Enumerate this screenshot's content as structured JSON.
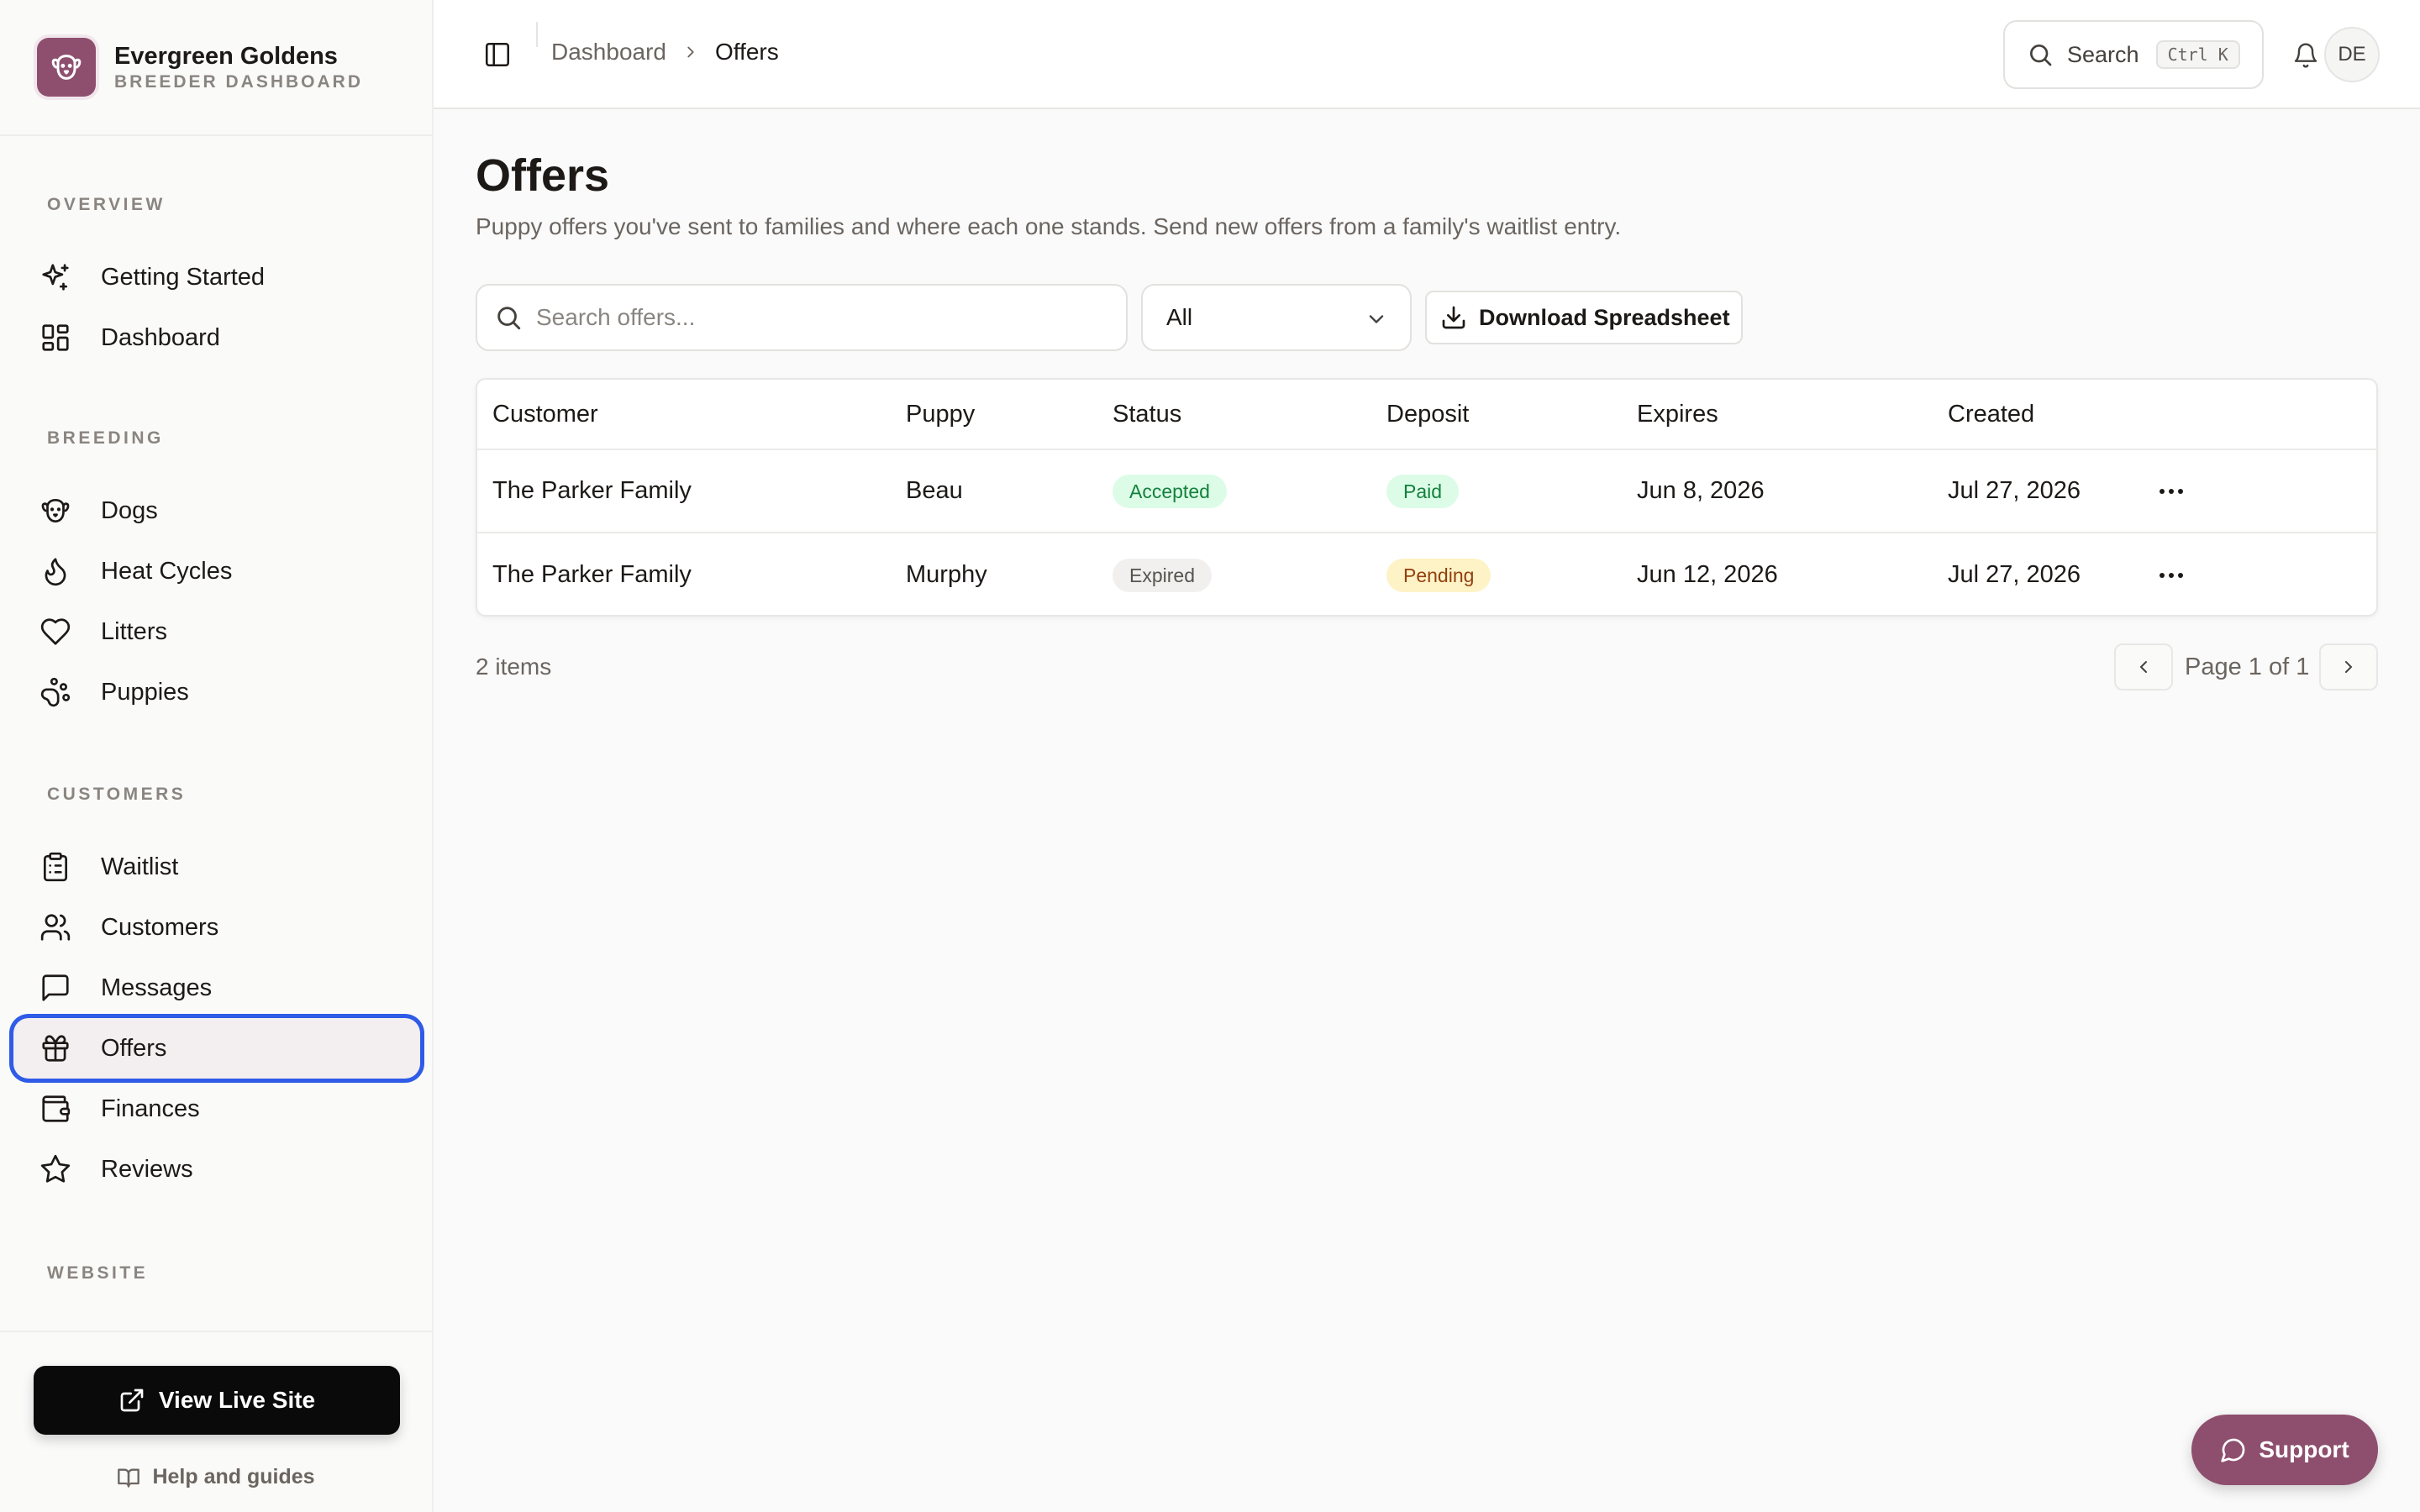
{
  "brand": {
    "name": "Evergreen Goldens",
    "subtitle": "BREEDER DASHBOARD",
    "logo_icon": "dog-face-icon",
    "color": "#8e4f6f"
  },
  "sidebar": {
    "sections": [
      {
        "label": "OVERVIEW",
        "items": [
          {
            "label": "Getting Started",
            "icon": "sparkles-icon"
          },
          {
            "label": "Dashboard",
            "icon": "layout-grid-icon"
          }
        ]
      },
      {
        "label": "BREEDING",
        "items": [
          {
            "label": "Dogs",
            "icon": "dog-icon"
          },
          {
            "label": "Heat Cycles",
            "icon": "flame-icon"
          },
          {
            "label": "Litters",
            "icon": "heart-icon"
          },
          {
            "label": "Puppies",
            "icon": "paw-icon"
          }
        ]
      },
      {
        "label": "CUSTOMERS",
        "items": [
          {
            "label": "Waitlist",
            "icon": "clipboard-list-icon"
          },
          {
            "label": "Customers",
            "icon": "users-icon"
          },
          {
            "label": "Messages",
            "icon": "message-square-icon"
          },
          {
            "label": "Offers",
            "icon": "gift-icon",
            "active": true
          },
          {
            "label": "Finances",
            "icon": "wallet-icon"
          },
          {
            "label": "Reviews",
            "icon": "star-icon"
          }
        ]
      },
      {
        "label": "WEBSITE",
        "items": []
      }
    ],
    "live_site_button": "View Live Site",
    "help_link": "Help and guides",
    "active_outline_color": "#2f5be7"
  },
  "topbar": {
    "breadcrumb": [
      "Dashboard",
      "Offers"
    ],
    "search_label": "Search",
    "search_shortcut": "Ctrl K",
    "avatar_initials": "DE"
  },
  "page": {
    "title": "Offers",
    "description": "Puppy offers you've sent to families and where each one stands. Send new offers from a family's waitlist entry.",
    "search_placeholder": "Search offers...",
    "filter_value": "All",
    "download_label": "Download Spreadsheet"
  },
  "table": {
    "columns": [
      "Customer",
      "Puppy",
      "Status",
      "Deposit",
      "Expires",
      "Created"
    ],
    "rows": [
      {
        "customer": "The Parker Family",
        "puppy": "Beau",
        "status": "Accepted",
        "deposit": "Paid",
        "expires": "Jun 8, 2026",
        "created": "Jul 27, 2026"
      },
      {
        "customer": "The Parker Family",
        "puppy": "Murphy",
        "status": "Expired",
        "deposit": "Pending",
        "expires": "Jun 12, 2026",
        "created": "Jul 27, 2026"
      }
    ]
  },
  "footer": {
    "items_count": "2 items",
    "page_label": "Page 1 of 1"
  },
  "support_button": "Support"
}
